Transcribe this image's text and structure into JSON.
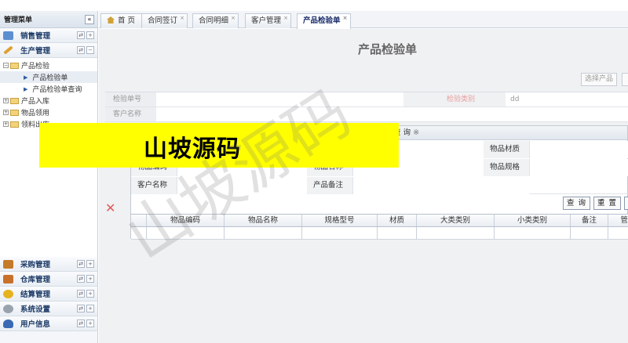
{
  "sidebar": {
    "title": "管理菜单",
    "collapse_icon": "«",
    "top_sections": [
      {
        "label": "销售管理",
        "icon": "cart-icon",
        "color": "#5b8fd0"
      },
      {
        "label": "生产管理",
        "icon": "wrench-icon",
        "color": "#e0a030"
      }
    ],
    "tree": {
      "root": "产品检验",
      "children": [
        "产品检验单",
        "产品检验单查询"
      ],
      "siblings": [
        "产品入库",
        "物品领用",
        "领料出库"
      ]
    },
    "bottom_sections": [
      {
        "label": "采购管理",
        "icon": "truck-icon",
        "color": "#c47a28"
      },
      {
        "label": "仓库管理",
        "icon": "box-icon",
        "color": "#c9712a"
      },
      {
        "label": "结算管理",
        "icon": "coins-icon",
        "color": "#e6b21f"
      },
      {
        "label": "系统设置",
        "icon": "gear-icon",
        "color": "#9aa3ad"
      },
      {
        "label": "用户信息",
        "icon": "user-icon",
        "color": "#3a6ab3"
      }
    ]
  },
  "tabs": [
    {
      "label": "首 页",
      "icon": "home-icon"
    },
    {
      "label": "合同签订"
    },
    {
      "label": "合同明细"
    },
    {
      "label": "客户管理"
    },
    {
      "label": "产品检验单",
      "active": true
    }
  ],
  "page": {
    "title": "产品检验单",
    "select_product_button": "选择产品",
    "form": {
      "inspection_no_label": "检验单号",
      "inspection_type_label": "检验类别",
      "inspection_type_value": "dd",
      "customer_label": "客户名称"
    }
  },
  "dialog": {
    "title": "查 询",
    "fields": {
      "material": "物品材质",
      "item_code": "物品编码",
      "item_name": "物品名称",
      "spec": "物品规格",
      "customer": "客户名称",
      "product_note": "产品备注"
    },
    "query_button": "查 询",
    "reset_button": "重 置",
    "columns": [
      "物品编码",
      "物品名称",
      "规格型号",
      "材质",
      "大类类别",
      "小类类别",
      "备注",
      "管"
    ]
  },
  "watermark": {
    "banner": "山坡源码",
    "faint": "山坡源码"
  }
}
